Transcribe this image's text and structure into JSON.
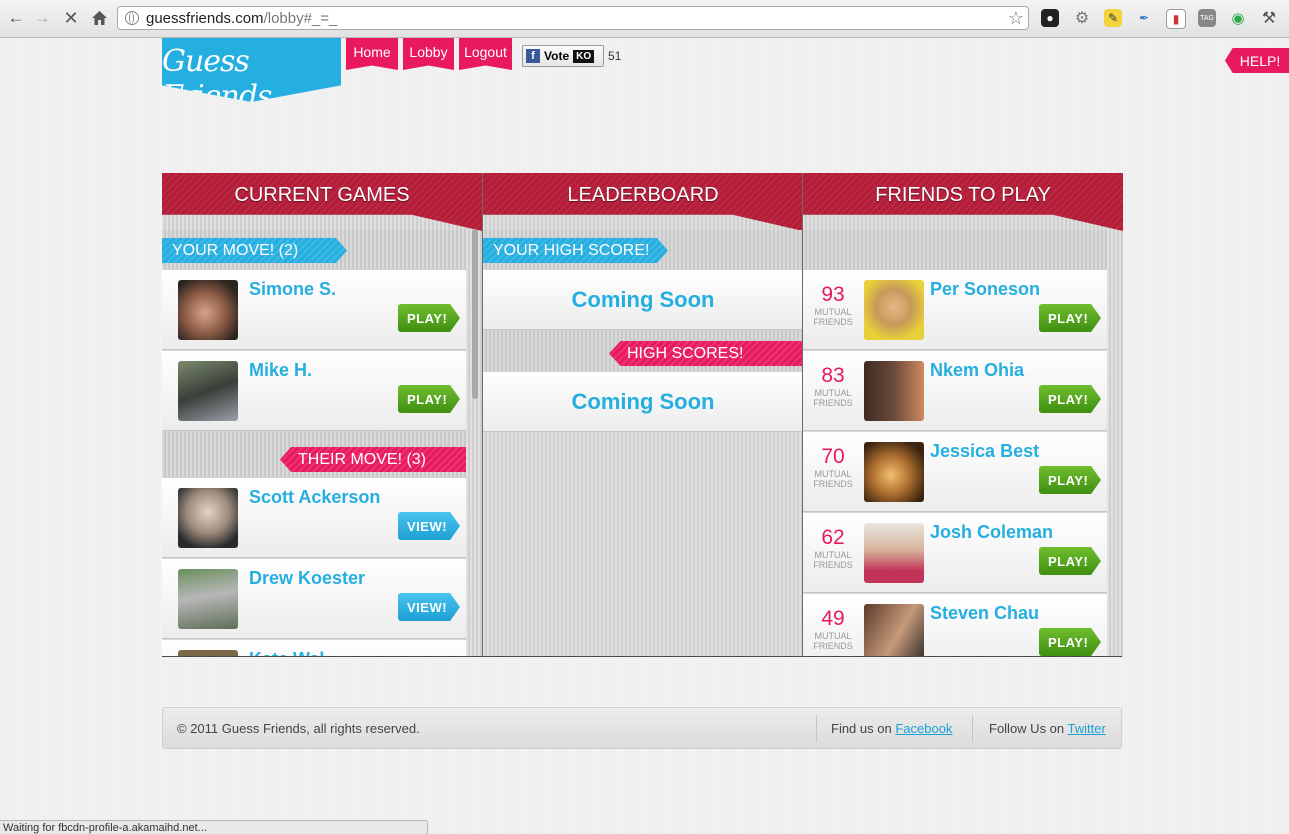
{
  "browser": {
    "url_host": "guessfriends.com",
    "url_path": "/lobby#_=_",
    "status": "Waiting for fbcdn-profile-a.akamaihd.net..."
  },
  "site": {
    "logo": "Guess Friends",
    "nav": [
      "Home",
      "Lobby",
      "Logout"
    ],
    "vote_label": "Vote",
    "vote_badge": "KO",
    "vote_count": "51",
    "help": "HELP!"
  },
  "current_games": {
    "title": "CURRENT GAMES",
    "your_move_label": "YOUR MOVE! (2)",
    "your_move": [
      {
        "name": "Simone S.",
        "action": "PLAY!"
      },
      {
        "name": "Mike H.",
        "action": "PLAY!"
      }
    ],
    "their_move_label": "THEIR MOVE! (3)",
    "their_move": [
      {
        "name": "Scott Ackerson",
        "action": "VIEW!"
      },
      {
        "name": "Drew Koester",
        "action": "VIEW!"
      },
      {
        "name": "Kate Wal",
        "action": ""
      }
    ]
  },
  "leaderboard": {
    "title": "LEADERBOARD",
    "your_high_score_label": "YOUR HIGH SCORE!",
    "your_high_score": "Coming Soon",
    "high_scores_label": "HIGH SCORES!",
    "high_scores": "Coming Soon"
  },
  "friends_to_play": {
    "title": "FRIENDS TO PLAY",
    "mutual_label_1": "MUTUAL",
    "mutual_label_2": "FRIENDS",
    "friends": [
      {
        "count": "93",
        "name": "Per Soneson",
        "action": "PLAY!"
      },
      {
        "count": "83",
        "name": "Nkem Ohia",
        "action": "PLAY!"
      },
      {
        "count": "70",
        "name": "Jessica Best",
        "action": "PLAY!"
      },
      {
        "count": "62",
        "name": "Josh Coleman",
        "action": "PLAY!"
      },
      {
        "count": "49",
        "name": "Steven Chau",
        "action": "PLAY!"
      }
    ]
  },
  "footer": {
    "copyright": "© 2011 Guess Friends, all rights reserved.",
    "find_us": "Find us on",
    "facebook": "Facebook",
    "follow_us": "Follow Us on",
    "twitter": "Twitter"
  },
  "colors": {
    "accent_blue": "#25aee0",
    "accent_pink": "#e8195e",
    "header_red": "#b41c38",
    "play_green": "#4f9f1a"
  }
}
